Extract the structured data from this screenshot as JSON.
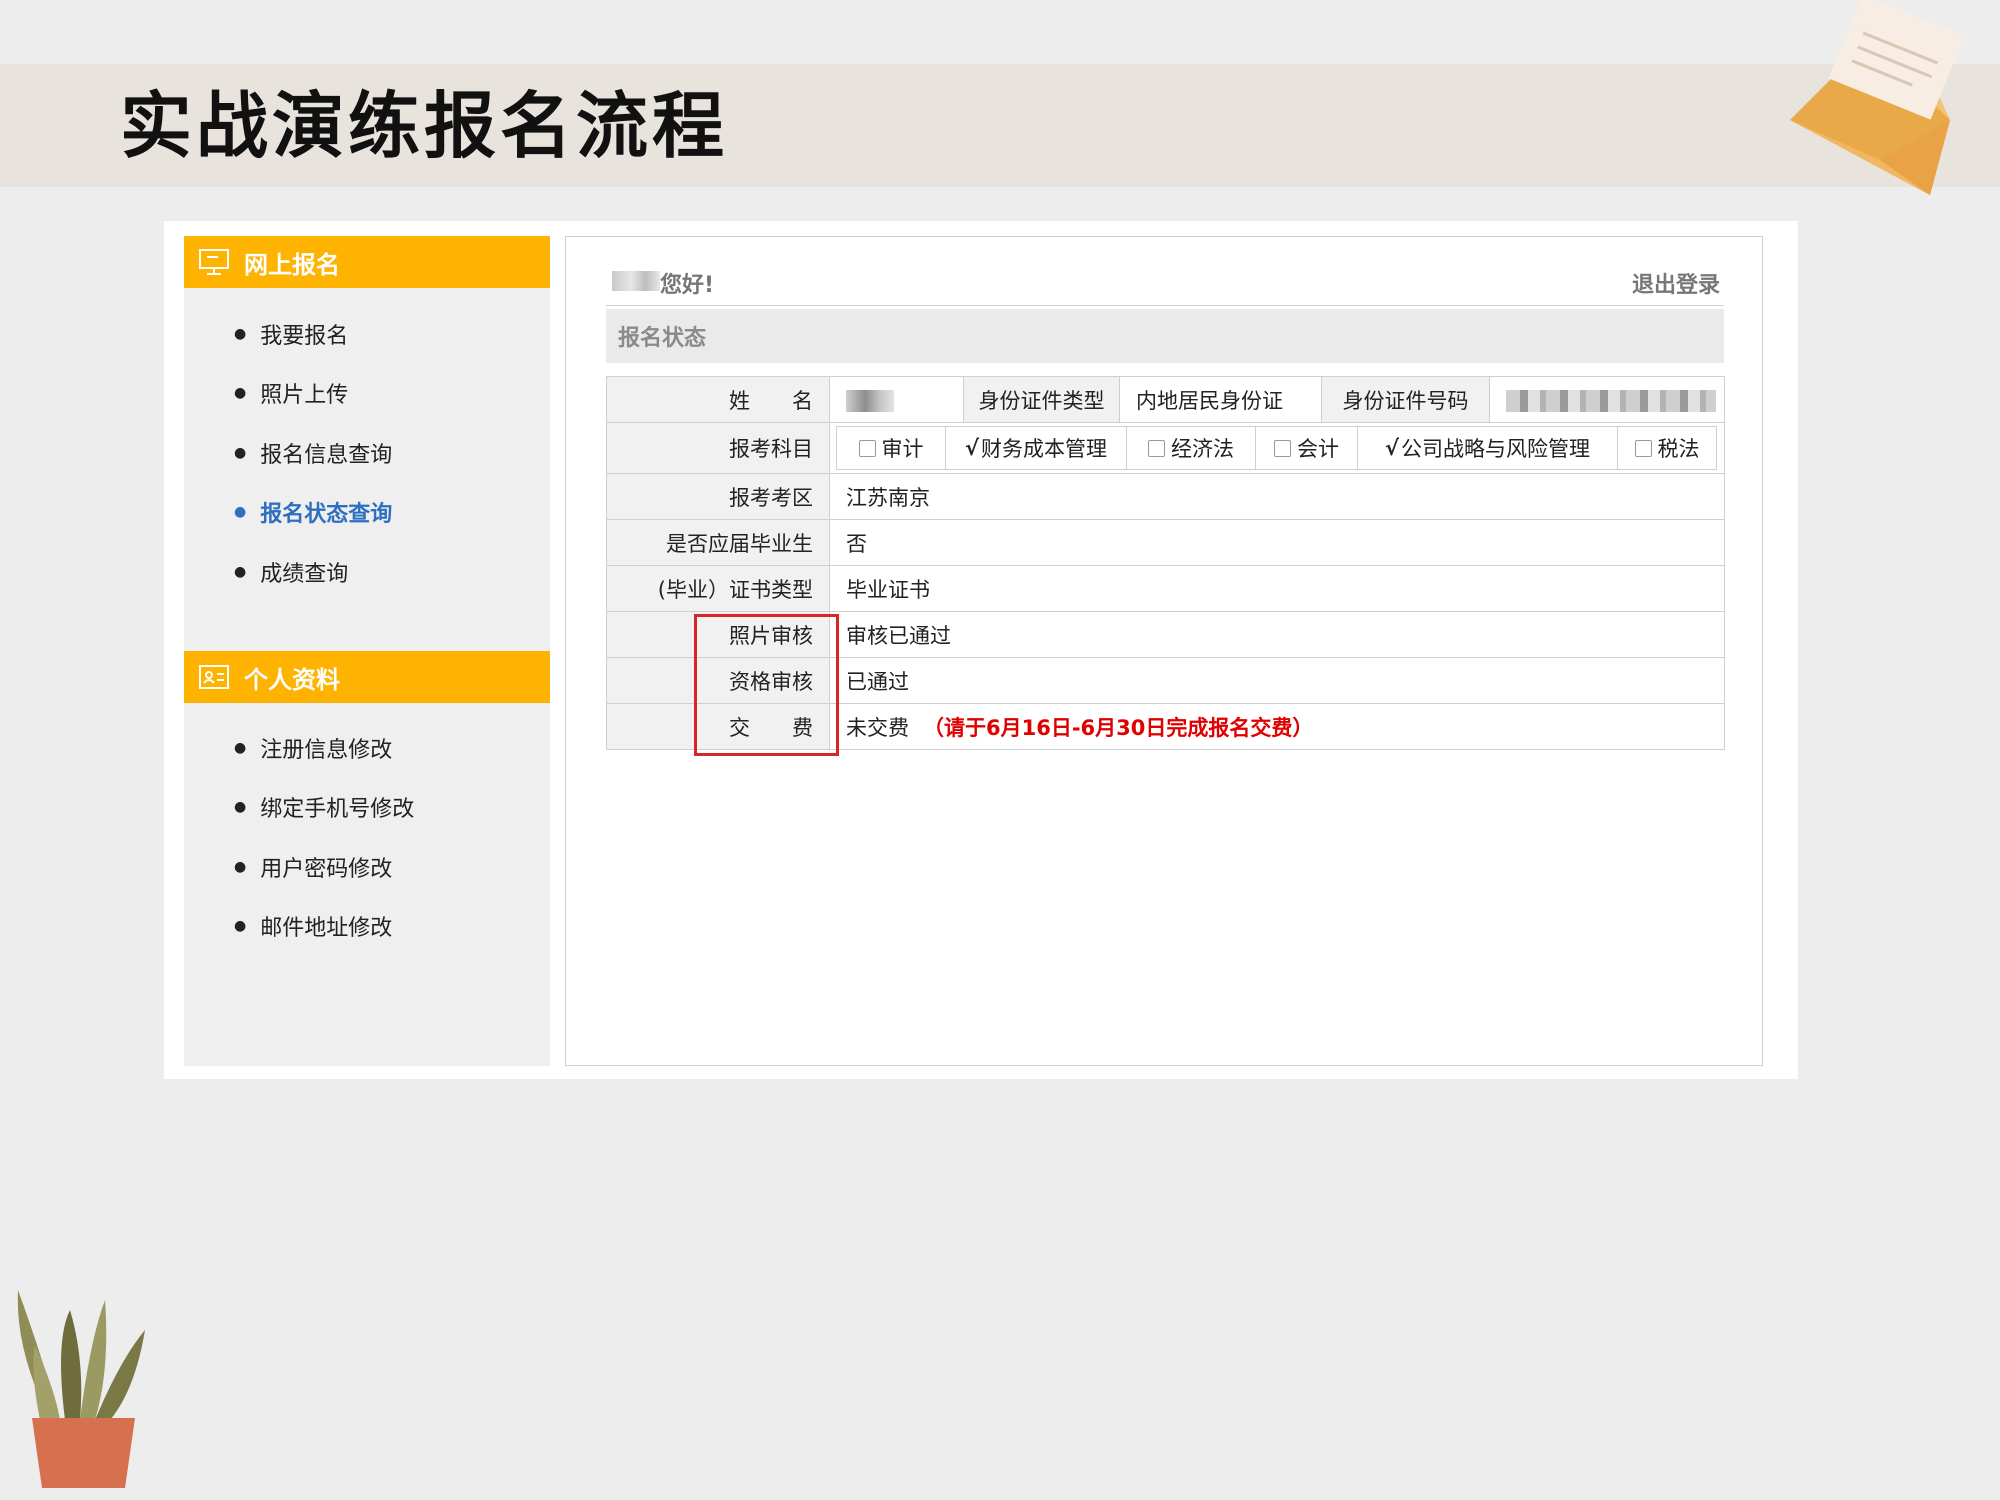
{
  "slide": {
    "title": "实战演练报名流程"
  },
  "sidebar": {
    "section1": {
      "title": "网上报名",
      "items": [
        {
          "label": "我要报名",
          "active": false
        },
        {
          "label": "照片上传",
          "active": false
        },
        {
          "label": "报名信息查询",
          "active": false
        },
        {
          "label": "报名状态查询",
          "active": true
        },
        {
          "label": "成绩查询",
          "active": false
        }
      ]
    },
    "section2": {
      "title": "个人资料",
      "items": [
        {
          "label": "注册信息修改"
        },
        {
          "label": "绑定手机号修改"
        },
        {
          "label": "用户密码修改"
        },
        {
          "label": "邮件地址修改"
        }
      ]
    }
  },
  "header": {
    "greeting": "您好!",
    "logout": "退出登录"
  },
  "section": {
    "title": "报名状态"
  },
  "table": {
    "name_label": "姓　　名",
    "id_type_label": "身份证件类型",
    "id_type_value": "内地居民身份证",
    "id_number_label": "身份证件号码",
    "subjects_label": "报考科目",
    "subjects": [
      {
        "label": "审计",
        "checked": false
      },
      {
        "label": "财务成本管理",
        "checked": true
      },
      {
        "label": "经济法",
        "checked": false
      },
      {
        "label": "会计",
        "checked": false
      },
      {
        "label": "公司战略与风险管理",
        "checked": true
      },
      {
        "label": "税法",
        "checked": false
      }
    ],
    "check_glyph": "√",
    "region_label": "报考考区",
    "region_value": "江苏南京",
    "graduate_label": "是否应届毕业生",
    "graduate_value": "否",
    "cert_label": "(毕业）证书类型",
    "cert_value": "毕业证书",
    "photo_label": "照片审核",
    "photo_value": "审核已通过",
    "qual_label": "资格审核",
    "qual_value": "已通过",
    "fee_label": "交　　费",
    "fee_value": "未交费",
    "fee_note": "（请于6月16日-6月30日完成报名交费）"
  },
  "colors": {
    "accent": "#fdb300",
    "active_link": "#2f6fc0",
    "alert": "#e00000",
    "highlight_box": "#d42828"
  }
}
